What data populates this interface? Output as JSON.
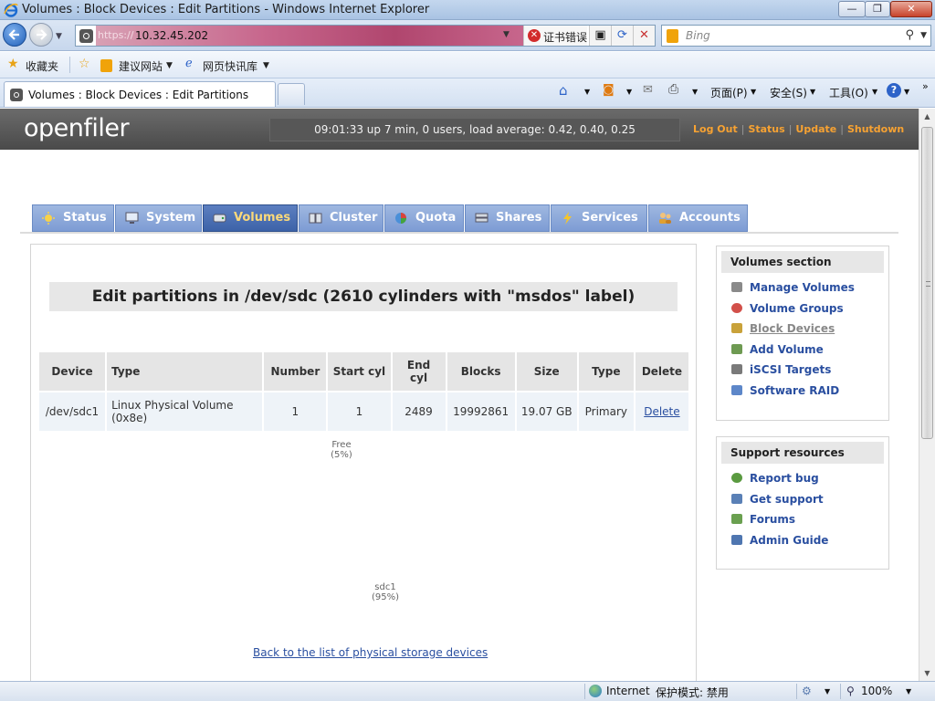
{
  "window": {
    "title": "Volumes : Block Devices : Edit Partitions - Windows Internet Explorer",
    "controls": {
      "minimize": "—",
      "restore": "❐",
      "close": "✕"
    }
  },
  "address": {
    "scheme": "https://",
    "host": "10.32.45.202",
    "cert_error": "证书错误",
    "search_placeholder": "Bing"
  },
  "favorites": {
    "favorites_label": "收藏夹",
    "suggested_sites": "建议网站",
    "web_slice_gallery": "网页快讯库"
  },
  "tabbar": {
    "tab_title": "Volumes : Block Devices : Edit Partitions",
    "page_menu": "页面(P)",
    "safety_menu": "安全(S)",
    "tools_menu": "工具(O)"
  },
  "openfiler": {
    "logo": "openfiler",
    "uptime": "09:01:33 up 7 min, 0 users, load average: 0.42, 0.40, 0.25",
    "top_links": [
      "Log Out",
      "Status",
      "Update",
      "Shutdown"
    ],
    "nav_tabs": [
      {
        "label": "Status",
        "icon": "sun-icon",
        "active": false
      },
      {
        "label": "System",
        "icon": "monitor-icon",
        "active": false
      },
      {
        "label": "Volumes",
        "icon": "disk-icon",
        "active": true
      },
      {
        "label": "Cluster",
        "icon": "servers-icon",
        "active": false
      },
      {
        "label": "Quota",
        "icon": "pie-icon",
        "active": false
      },
      {
        "label": "Shares",
        "icon": "drive-icon",
        "active": false
      },
      {
        "label": "Services",
        "icon": "lightning-icon",
        "active": false
      },
      {
        "label": "Accounts",
        "icon": "users-icon",
        "active": false
      }
    ]
  },
  "main": {
    "heading": "Edit partitions in /dev/sdc (2610 cylinders with \"msdos\" label)",
    "table": {
      "headers": [
        "Device",
        "Type",
        "Number",
        "Start cyl",
        "End cyl",
        "Blocks",
        "Size",
        "Type",
        "Delete"
      ],
      "rows": [
        {
          "device": "/dev/sdc1",
          "type": "Linux Physical Volume (0x8e)",
          "number": "1",
          "start_cyl": "1",
          "end_cyl": "2489",
          "blocks": "19992861",
          "size": "19.07 GB",
          "ptype": "Primary",
          "delete": "Delete"
        }
      ]
    },
    "pie": {
      "free_label": "Free",
      "free_pct": "(5%)",
      "sdc1_label": "sdc1",
      "sdc1_pct": "(95%)"
    },
    "back_link": "Back to the list of physical storage devices"
  },
  "sidebar": {
    "volumes_section": {
      "title": "Volumes section",
      "items": [
        {
          "label": "Manage Volumes",
          "icon": "manage-volumes-icon",
          "color": "#8a8a8a"
        },
        {
          "label": "Volume Groups",
          "icon": "volume-groups-icon",
          "color": "#d2504a"
        },
        {
          "label": "Block Devices",
          "icon": "block-devices-icon",
          "color": "#c9a23a",
          "current": true
        },
        {
          "label": "Add Volume",
          "icon": "add-volume-icon",
          "color": "#6e9a52"
        },
        {
          "label": "iSCSI Targets",
          "icon": "iscsi-targets-icon",
          "color": "#7a7a7a"
        },
        {
          "label": "Software RAID",
          "icon": "software-raid-icon",
          "color": "#5d87c9"
        }
      ]
    },
    "support_resources": {
      "title": "Support resources",
      "items": [
        {
          "label": "Report bug",
          "icon": "bug-icon",
          "color": "#5a9a40"
        },
        {
          "label": "Get support",
          "icon": "support-icon",
          "color": "#5a80b6"
        },
        {
          "label": "Forums",
          "icon": "forums-icon",
          "color": "#6aa050"
        },
        {
          "label": "Admin Guide",
          "icon": "guide-icon",
          "color": "#4f76b0"
        }
      ]
    }
  },
  "statusbar": {
    "zone": "Internet",
    "protected_mode": "保护模式: 禁用",
    "zoom": "100%"
  },
  "colors": {
    "accent_orange": "#f7a232",
    "link_blue": "#2a4fa0",
    "nav_active": "#3d63a8",
    "header_dark": "#4a4a4a"
  }
}
